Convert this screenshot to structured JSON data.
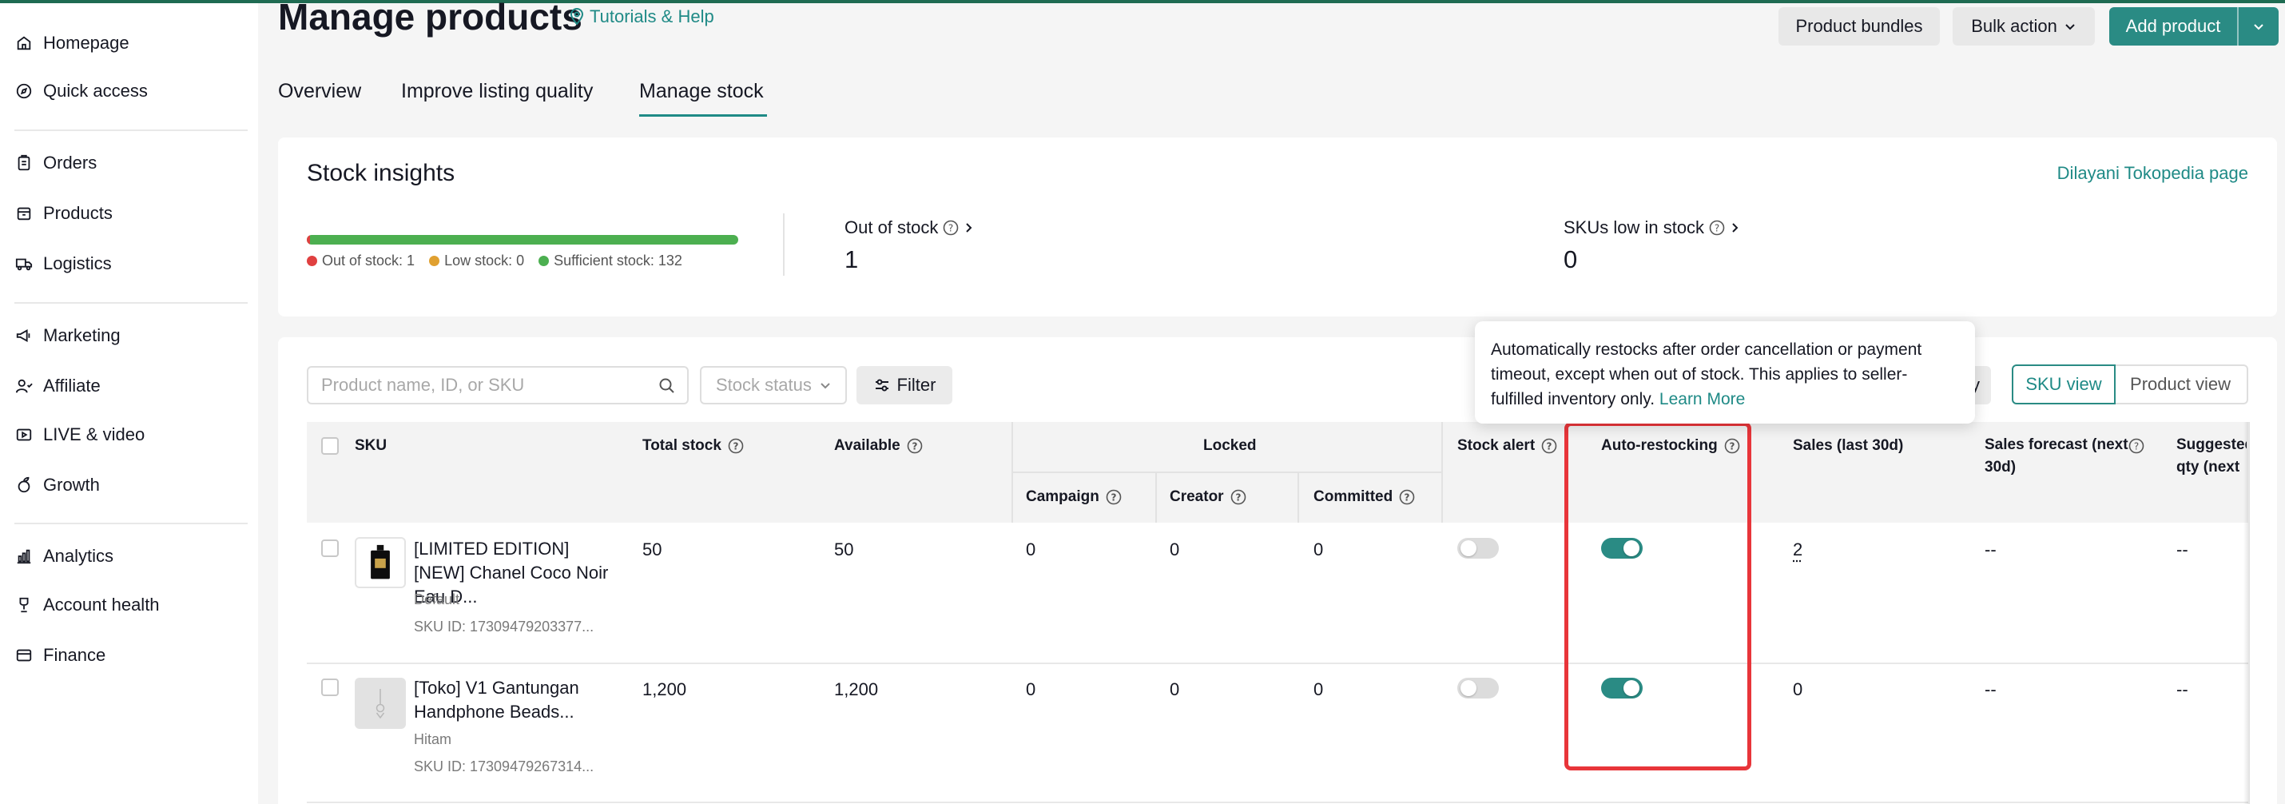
{
  "sidebar": {
    "items": [
      {
        "label": "Homepage",
        "icon": "home-icon"
      },
      {
        "label": "Quick access",
        "icon": "compass-icon"
      },
      {
        "label": "Orders",
        "icon": "clipboard-icon"
      },
      {
        "label": "Products",
        "icon": "box-icon"
      },
      {
        "label": "Logistics",
        "icon": "truck-icon"
      },
      {
        "label": "Marketing",
        "icon": "megaphone-icon"
      },
      {
        "label": "Affiliate",
        "icon": "people-icon"
      },
      {
        "label": "LIVE & video",
        "icon": "video-icon"
      },
      {
        "label": "Growth",
        "icon": "sprout-icon"
      },
      {
        "label": "Analytics",
        "icon": "bar-chart-icon"
      },
      {
        "label": "Account health",
        "icon": "trophy-icon"
      },
      {
        "label": "Finance",
        "icon": "wallet-icon"
      }
    ]
  },
  "header": {
    "title": "Manage products",
    "tutorials_link": "Tutorials & Help",
    "product_bundles": "Product bundles",
    "bulk_action": "Bulk action",
    "add_product": "Add product"
  },
  "tabs": [
    {
      "label": "Overview"
    },
    {
      "label": "Improve listing quality"
    },
    {
      "label": "Manage stock",
      "active": true
    }
  ],
  "insights": {
    "title": "Stock insights",
    "served_link": "Dilayani Tokopedia page",
    "out_of_stock_fraction": 0.0075,
    "legend": {
      "out": "Out of stock: 1",
      "low": "Low stock: 0",
      "sufficient": "Sufficient stock: 132"
    },
    "metrics": {
      "out_of_stock_label": "Out of stock",
      "out_of_stock_value": "1",
      "low_label": "SKUs low in stock",
      "low_value": "0"
    },
    "colors": {
      "out": "#e04040",
      "low": "#e0a030",
      "sufficient": "#4caf50"
    }
  },
  "toolbar": {
    "search_placeholder": "Product name, ID, or SKU",
    "stock_status": "Stock status",
    "filter": "Filter",
    "partial_button": "py",
    "sku_view": "SKU view",
    "product_view": "Product view"
  },
  "table": {
    "headers": {
      "sku": "SKU",
      "total_stock": "Total stock",
      "available": "Available",
      "locked": "Locked",
      "campaign": "Campaign",
      "creator": "Creator",
      "committed": "Committed",
      "stock_alert": "Stock alert",
      "auto_restocking": "Auto-restocking",
      "sales": "Sales (last 30d)",
      "forecast": "Sales forecast (next 30d)",
      "suggested": "Suggested qty (next"
    },
    "rows": [
      {
        "name": "[LIMITED EDITION] [NEW] Chanel Coco Noir Eau D...",
        "variant": "Default",
        "sku_id": "SKU ID: 17309479203377...",
        "total": "50",
        "available": "50",
        "campaign": "0",
        "creator": "0",
        "committed": "0",
        "stock_alert": false,
        "auto_restocking": true,
        "sales": "2",
        "forecast": "--",
        "suggested": "--"
      },
      {
        "name": "[Toko] V1 Gantungan Handphone Beads...",
        "variant": "Hitam",
        "sku_id": "SKU ID: 17309479267314...",
        "total": "1,200",
        "available": "1,200",
        "campaign": "0",
        "creator": "0",
        "committed": "0",
        "stock_alert": false,
        "auto_restocking": true,
        "sales": "0",
        "forecast": "--",
        "suggested": "--"
      }
    ]
  },
  "tooltip": {
    "text": "Automatically restocks after order cancellation or payment timeout, except when out of stock. This applies to seller-fulfilled inventory only.",
    "learn_more": "Learn More"
  },
  "colors": {
    "accent": "#2a8b84",
    "highlight": "#e8353a"
  }
}
